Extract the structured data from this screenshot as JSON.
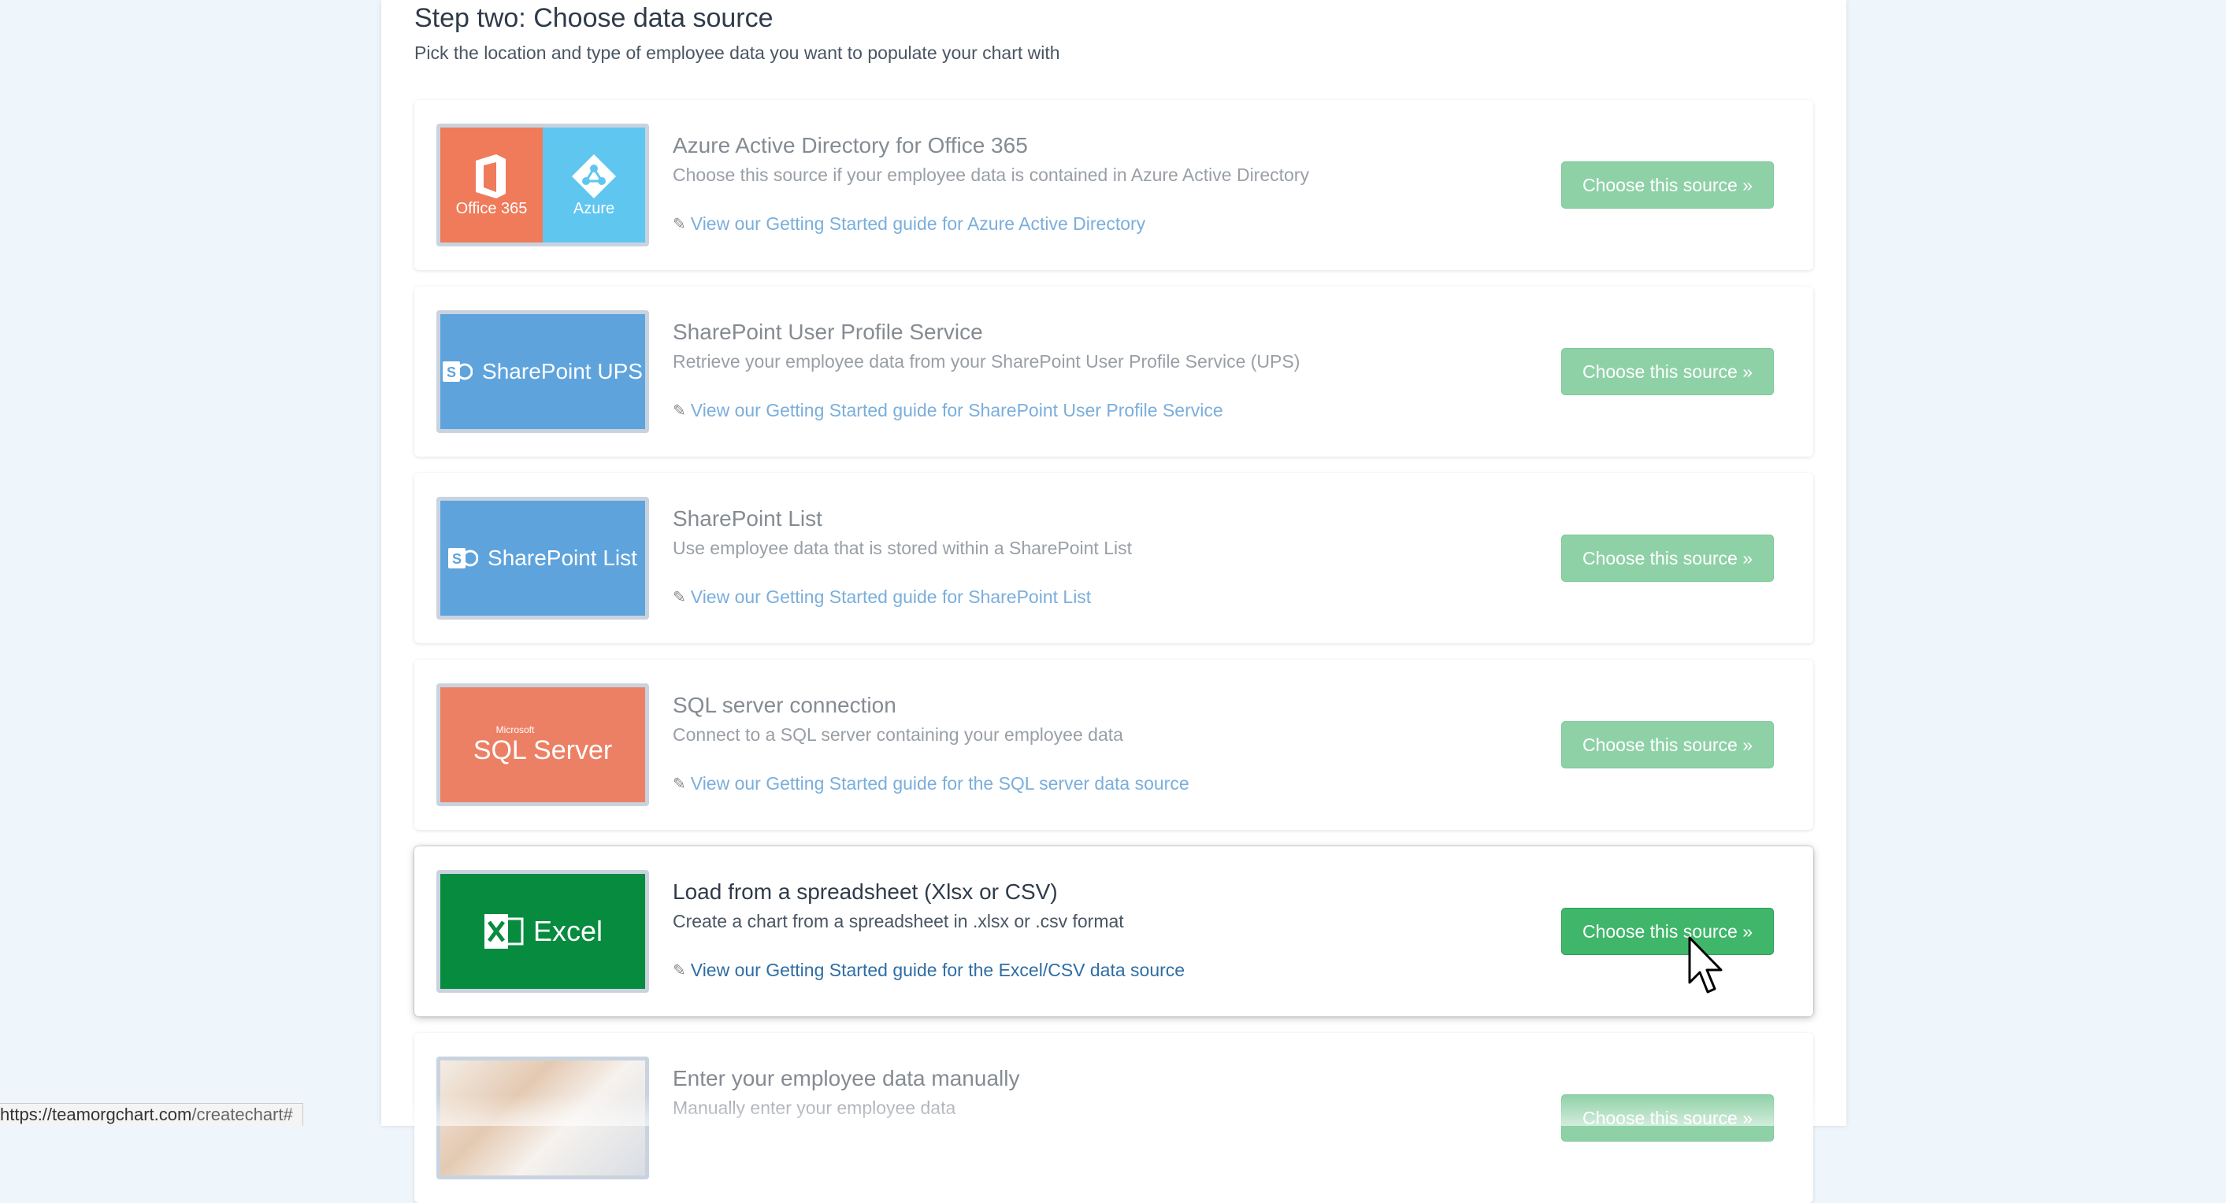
{
  "header": {
    "title": "Step two: Choose data source",
    "subtitle": "Pick the location and type of employee data you want to populate your chart with"
  },
  "sources": [
    {
      "title": "Azure Active Directory for Office 365",
      "description": "Choose this source if your employee data is contained in Azure Active Directory",
      "guide_link": "View our Getting Started guide for Azure Active Directory",
      "button": "Choose this source »",
      "logo_labels": [
        "Office 365",
        "Azure"
      ],
      "logo_colors": [
        "#ef7b5b",
        "#5fc6f0"
      ]
    },
    {
      "title": "SharePoint User Profile Service",
      "description": "Retrieve your employee data from your SharePoint User Profile Service (UPS)",
      "guide_link": "View our Getting Started guide for SharePoint User Profile Service",
      "button": "Choose this source »",
      "logo_labels": [
        "SharePoint UPS"
      ],
      "logo_colors": [
        "#5ea3dc"
      ]
    },
    {
      "title": "SharePoint List",
      "description": "Use employee data that is stored within a SharePoint List",
      "guide_link": "View our Getting Started guide for SharePoint List",
      "button": "Choose this source »",
      "logo_labels": [
        "SharePoint List"
      ],
      "logo_colors": [
        "#5ea3dc"
      ]
    },
    {
      "title": "SQL server connection",
      "description": "Connect to a SQL server containing your employee data",
      "guide_link": "View our Getting Started guide for the SQL server data source",
      "button": "Choose this source »",
      "logo_labels": [
        "Microsoft",
        "SQL Server"
      ],
      "logo_colors": [
        "#ec8064"
      ]
    },
    {
      "title": "Load from a spreadsheet (Xlsx or CSV)",
      "description": "Create a chart from a spreadsheet in .xlsx or .csv format",
      "guide_link": "View our Getting Started guide for the Excel/CSV data source",
      "button": "Choose this source »",
      "logo_labels": [
        "Excel"
      ],
      "logo_colors": [
        "#078b3f"
      ]
    },
    {
      "title": "Enter your employee data manually",
      "description": "Manually enter your employee data",
      "button": "Choose this source »"
    }
  ],
  "status_bar": {
    "domain": "https://teamorgchart.com",
    "path": "/createchart#"
  }
}
